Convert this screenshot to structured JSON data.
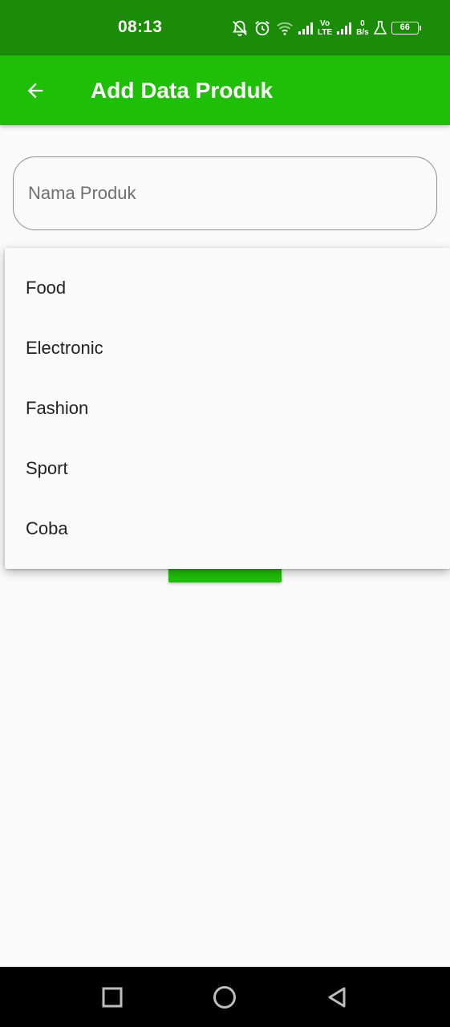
{
  "status_bar": {
    "time": "08:13",
    "volte_top": "Vo",
    "volte_bottom": "LTE",
    "net_speed_value": "0",
    "net_speed_unit": "B/s",
    "battery": "66"
  },
  "app_bar": {
    "title": "Add Data Produk",
    "back_icon": "arrow-back-icon",
    "background": "#1fbf08"
  },
  "form": {
    "nama_produk": {
      "placeholder": "Nama Produk",
      "value": ""
    }
  },
  "dropdown": {
    "options": [
      "Food",
      "Electronic",
      "Fashion",
      "Sport",
      "Coba"
    ]
  },
  "colors": {
    "status_bar": "#1a8c08",
    "accent": "#1fbf08",
    "background": "#fafafa"
  },
  "nav_bar": {
    "icons": [
      "recents-square-icon",
      "home-circle-icon",
      "back-triangle-icon"
    ]
  }
}
